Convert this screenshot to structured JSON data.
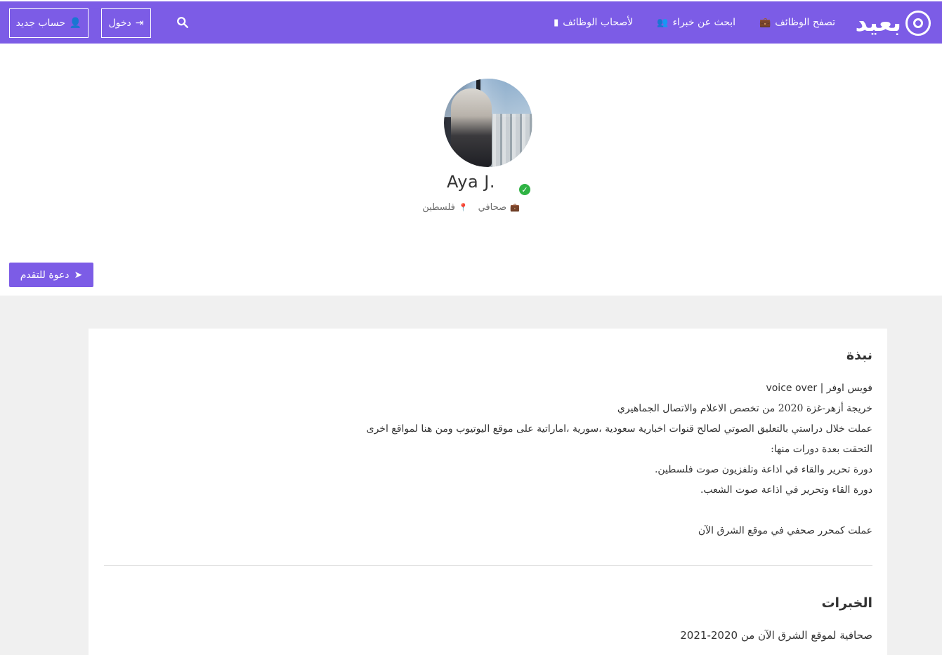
{
  "header": {
    "logo_text": "بعيد",
    "nav": [
      {
        "label": "تصفح الوظائف",
        "icon": "briefcase-icon"
      },
      {
        "label": "ابحث عن خبراء",
        "icon": "users-icon"
      },
      {
        "label": "لأصحاب الوظائف",
        "icon": "building-icon"
      }
    ],
    "login_label": "دخول",
    "register_label": "حساب جديد",
    "search_icon": "search-icon"
  },
  "profile": {
    "name": "Aya J.",
    "title": "صحافي",
    "location": "فلسطين",
    "verified": true,
    "invite_label": "دعوة للتقدم"
  },
  "about": {
    "title": "نبذة",
    "lines": [
      "فويس اوفر | voice over",
      "خريجة أزهر-غزة 2020 من تخصص الاعلام والاتصال الجماهيري",
      "عملت خلال دراستي بالتعليق الصوتي لصالح قنوات اخبارية سعودية ،سورية ،اماراتية على موقع اليوتيوب ومن هنا لمواقع اخرى",
      "التحقت بعدة دورات منها:",
      "دورة تحرير والقاء في اذاعة وتلفزيون صوت فلسطين.",
      "دورة القاء وتحرير في اذاعة صوت الشعب.",
      "",
      "عملت كمحرر صحفي في موقع الشرق الآن"
    ]
  },
  "experience": {
    "title": "الخبرات",
    "items": [
      "صحافية لموقع الشرق الآن من 2020-2021"
    ]
  },
  "colors": {
    "brand": "#7c5ce6",
    "verified": "#2fb344",
    "page_bg": "#f0f0f0"
  }
}
